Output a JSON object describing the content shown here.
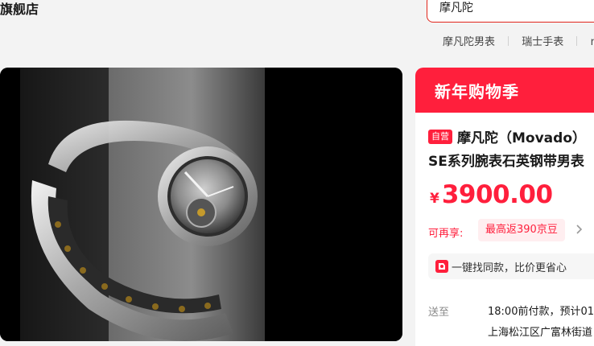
{
  "header": {
    "store_name": "旗舰店",
    "search": {
      "value": "摩凡陀"
    },
    "hot_words": [
      "摩凡陀男表",
      "瑞士手表",
      "m"
    ]
  },
  "gallery": {
    "image_icon": "watch-photo",
    "background": "#000000"
  },
  "promo": {
    "title": "新年购物季",
    "color": "#ff1f3c"
  },
  "product": {
    "badge": "自营",
    "title_line1": "摩凡陀（Movado）",
    "title_line2": "SE系列腕表石英钢带男表",
    "price": {
      "currency": "¥",
      "value": "3900.00"
    },
    "benefit": {
      "label": "可再享:",
      "chip": "最高返390京豆",
      "icon": "chevron-right-icon"
    },
    "find_similar": {
      "text": "一键找同款，比价更省心",
      "icon": "find-similar-icon"
    },
    "shipping": {
      "label": "送至",
      "value": "18:00前付款，预计01",
      "sub": "上海松江区广富林街道"
    }
  }
}
